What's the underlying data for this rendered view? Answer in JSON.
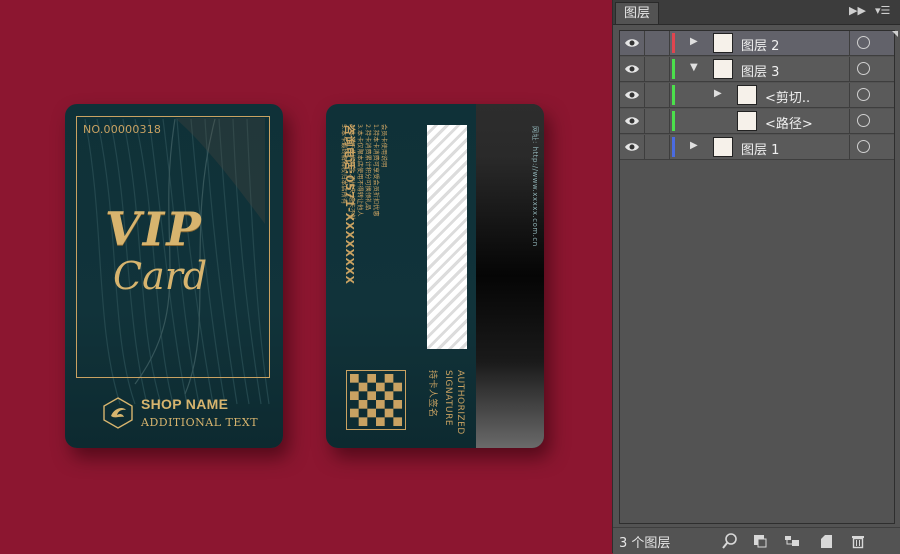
{
  "card_front": {
    "number": "NO.00000318",
    "vip": "VIP",
    "card": "Card",
    "shop_name": "SHOP NAME",
    "additional_text": "ADDITIONAL TEXT"
  },
  "card_back": {
    "rules": [
      "会员卡使用说明",
      "1.持本卡消费可享受会员折扣优惠",
      "2.持卡消费累计积分可换领礼品",
      "3.本卡仅限本店使用不得转让他人",
      "4.本卡不兑换现金,不挂失,遗失不补",
      "5.本卡最终解释权归本店所有"
    ],
    "phone": "咨询电话:0571-XXXXXXXX",
    "website": "网址: http://www.xxxxx.com.cn",
    "authorized": "AUTHORIZED",
    "signature": "SIGNATURE",
    "holder_signature": "持卡人签名"
  },
  "panel": {
    "tab_title": "图层",
    "layers": [
      {
        "name": "图层 2",
        "color": "#e0454f",
        "expanded": false,
        "indent": 0,
        "selected": true
      },
      {
        "name": "图层 3",
        "color": "#4be04b",
        "expanded": true,
        "indent": 0,
        "selected": false
      },
      {
        "name": "<剪切..",
        "color": "#4be04b",
        "expanded": false,
        "indent": 1,
        "selected": false
      },
      {
        "name": "<路径>",
        "color": "#4be04b",
        "expanded": null,
        "indent": 1,
        "selected": false
      },
      {
        "name": "图层 1",
        "color": "#4a6be0",
        "expanded": false,
        "indent": 0,
        "selected": false
      }
    ],
    "footer_count": "3 个图层",
    "footer_buttons": [
      "locate-object-icon",
      "make-clipping-mask-icon",
      "create-sublayer-icon",
      "new-layer-icon",
      "delete-layer-icon"
    ]
  },
  "colors": {
    "canvas_bg": "#8c1630",
    "gold": "#d7b46e",
    "card_teal": "#0f3138",
    "panel_bg": "#535353"
  }
}
